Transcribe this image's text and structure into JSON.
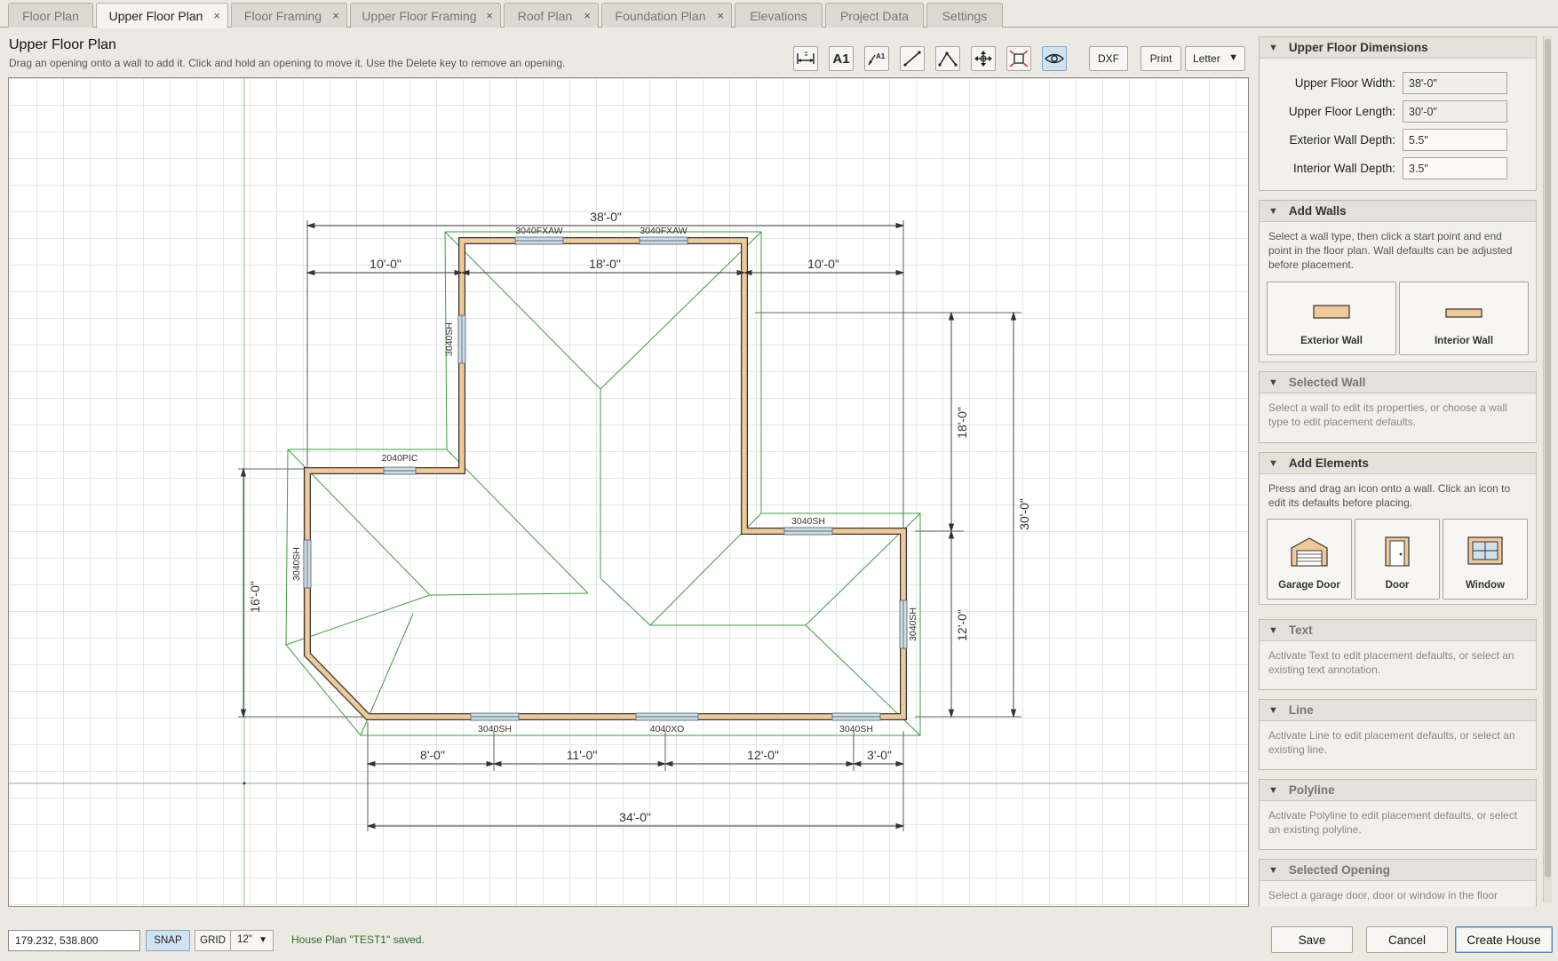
{
  "tabs": [
    {
      "label": "Floor Plan",
      "closable": false,
      "active": false
    },
    {
      "label": "Upper Floor Plan",
      "closable": true,
      "active": true
    },
    {
      "label": "Floor Framing",
      "closable": true,
      "active": false
    },
    {
      "label": "Upper Floor Framing",
      "closable": true,
      "active": false
    },
    {
      "label": "Roof Plan",
      "closable": true,
      "active": false
    },
    {
      "label": "Foundation Plan",
      "closable": true,
      "active": false
    },
    {
      "label": "Elevations",
      "closable": false,
      "active": false
    },
    {
      "label": "Project Data",
      "closable": false,
      "active": false
    },
    {
      "label": "Settings",
      "closable": false,
      "active": false
    }
  ],
  "close_glyph": "×",
  "header": {
    "title": "Upper Floor Plan",
    "subtitle": "Drag an opening onto a wall to add it. Click and hold an opening to move it. Use the Delete key to remove an opening."
  },
  "toolbar": {
    "tools": [
      {
        "name": "dimension-tool-icon",
        "active": false
      },
      {
        "name": "text-tool-icon",
        "label": "A1",
        "active": false
      },
      {
        "name": "leader-text-icon",
        "label": "A1",
        "active": false
      },
      {
        "name": "line-tool-icon",
        "active": false
      },
      {
        "name": "polyline-tool-icon",
        "active": false
      },
      {
        "name": "move-tool-icon",
        "active": false
      },
      {
        "name": "zoom-extents-icon",
        "active": false
      },
      {
        "name": "visibility-eye-icon",
        "active": true
      }
    ],
    "dxf_label": "DXF",
    "print_label": "Print",
    "paper_size": "Letter"
  },
  "drawing": {
    "dimensions": {
      "overall_width": "38'-0\"",
      "top_left": "10'-0\"",
      "top_middle": "18'-0\"",
      "top_right": "10'-0\"",
      "right_upper": "18'-0\"",
      "right_lower": "12'-0\"",
      "right_overall": "30'-0\"",
      "left_lower": "16'-0\"",
      "bottom_1": "8'-0\"",
      "bottom_2": "11'-0\"",
      "bottom_3": "12'-0\"",
      "bottom_4": "3'-0\"",
      "bottom_overall": "34'-0\""
    },
    "openings": {
      "top_1": "3040FXAW",
      "top_2": "3040FXAW",
      "upper_left_wall": "3040SH",
      "step_wall": "2040PIC",
      "left_wall": "3040SH",
      "right_step": "3040SH",
      "right_wall": "3040SH",
      "bottom_1": "3040SH",
      "bottom_2": "4040XO",
      "bottom_3": "3040SH"
    },
    "colors": {
      "wall": "#f0c998",
      "roof_line": "#3f9b3f",
      "dimension": "#333333"
    }
  },
  "panel": {
    "dimensions": {
      "title": "Upper Floor Dimensions",
      "fields": [
        {
          "label": "Upper Floor Width:",
          "value": "38'-0\"",
          "editable": false
        },
        {
          "label": "Upper Floor Length:",
          "value": "30'-0\"",
          "editable": false
        },
        {
          "label": "Exterior Wall Depth:",
          "value": "5.5\"",
          "editable": true
        },
        {
          "label": "Interior Wall Depth:",
          "value": "3.5\"",
          "editable": true
        }
      ]
    },
    "add_walls": {
      "title": "Add Walls",
      "text": "Select a wall type, then click a start point and end point in the floor plan. Wall defaults can be adjusted before placement.",
      "exterior_label": "Exterior Wall",
      "interior_label": "Interior Wall"
    },
    "selected_wall": {
      "title": "Selected Wall",
      "text": "Select a wall to edit its properties, or choose a wall type to edit placement defaults."
    },
    "add_elements": {
      "title": "Add Elements",
      "text": "Press and drag an icon onto a wall. Click an icon to edit its defaults before placing.",
      "garage_label": "Garage Door",
      "door_label": "Door",
      "window_label": "Window"
    },
    "text_section": {
      "title": "Text",
      "text": "Activate Text to edit placement defaults, or select an existing text annotation."
    },
    "line_section": {
      "title": "Line",
      "text": "Activate Line to edit placement defaults, or select an existing line."
    },
    "polyline_section": {
      "title": "Polyline",
      "text": "Activate Polyline to edit placement defaults, or select an existing polyline."
    },
    "selected_opening": {
      "title": "Selected Opening",
      "text": "Select a garage door, door or window in the floor"
    }
  },
  "statusbar": {
    "coordinates": "179.232, 538.800",
    "snap_label": "SNAP",
    "grid_label": "GRID",
    "grid_size": "12\"",
    "message": "House Plan \"TEST1\" saved."
  },
  "footer": {
    "save_label": "Save",
    "cancel_label": "Cancel",
    "create_label": "Create House"
  }
}
